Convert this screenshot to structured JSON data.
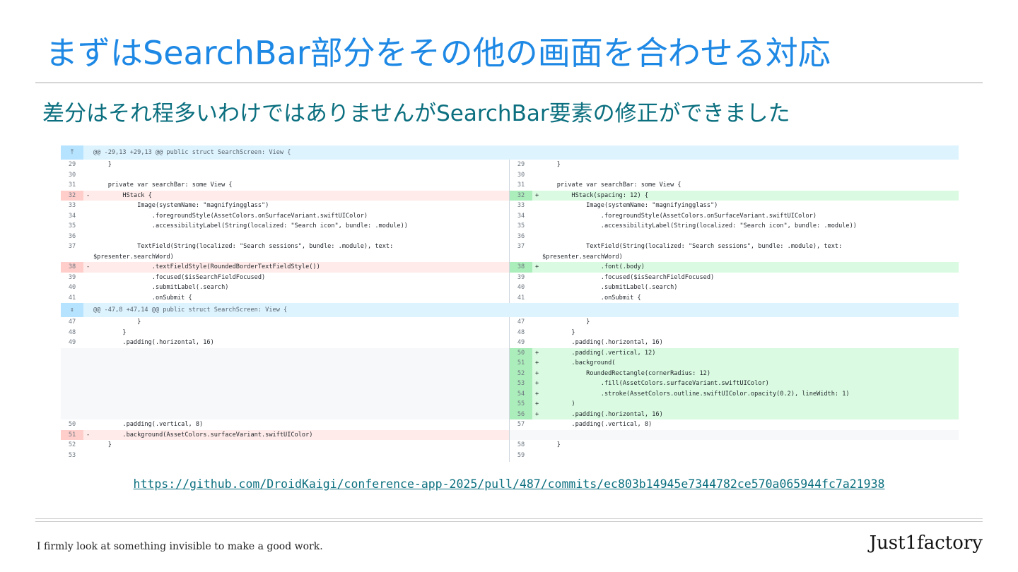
{
  "slide": {
    "title": "まずはSearchBar部分をその他の画面を合わせる対応",
    "subtitle": "差分はそれ程多いわけではありませんがSearchBar要素の修正ができました",
    "link": "https://github.com/DroidKaigi/conference-app-2025/pull/487/commits/ec803b14945e7344782ce570a065944fc7a21938",
    "footer_tagline": "I firmly look at something invisible to make a good work.",
    "brand": "Just1factory"
  },
  "diff": {
    "hunks": [
      {
        "expand_icon": "expand-up-icon",
        "header": "@@ -29,13 +29,13 @@ public struct SearchScreen: View {"
      },
      {
        "expand_icon": "expand-both-icon",
        "header": "@@ -47,8 +47,14 @@ public struct SearchScreen: View {"
      }
    ],
    "left": [
      {
        "num": "29",
        "sign": "",
        "type": "ctx",
        "code": "    }"
      },
      {
        "num": "30",
        "sign": "",
        "type": "ctx",
        "code": ""
      },
      {
        "num": "31",
        "sign": "",
        "type": "ctx",
        "code": "    private var searchBar: some View {"
      },
      {
        "num": "32",
        "sign": "-",
        "type": "del",
        "code": "        HStack {"
      },
      {
        "num": "33",
        "sign": "",
        "type": "ctx",
        "code": "            Image(systemName: \"magnifyingglass\")"
      },
      {
        "num": "34",
        "sign": "",
        "type": "ctx",
        "code": "                .foregroundStyle(AssetColors.onSurfaceVariant.swiftUIColor)"
      },
      {
        "num": "35",
        "sign": "",
        "type": "ctx",
        "code": "                .accessibilityLabel(String(localized: \"Search icon\", bundle: .module))"
      },
      {
        "num": "36",
        "sign": "",
        "type": "ctx",
        "code": ""
      },
      {
        "num": "37",
        "sign": "",
        "type": "ctx",
        "code": "            TextField(String(localized: \"Search sessions\", bundle: .module), text:"
      },
      {
        "num": "",
        "sign": "",
        "type": "ctx",
        "code": "$presenter.searchWord)"
      },
      {
        "num": "38",
        "sign": "-",
        "type": "del",
        "code": "                .textFieldStyle(RoundedBorderTextFieldStyle())"
      },
      {
        "num": "39",
        "sign": "",
        "type": "ctx",
        "code": "                .focused($isSearchFieldFocused)"
      },
      {
        "num": "40",
        "sign": "",
        "type": "ctx",
        "code": "                .submitLabel(.search)"
      },
      {
        "num": "41",
        "sign": "",
        "type": "ctx",
        "code": "                .onSubmit {"
      },
      {
        "num": "47",
        "sign": "",
        "type": "ctx",
        "code": "            }"
      },
      {
        "num": "48",
        "sign": "",
        "type": "ctx",
        "code": "        }"
      },
      {
        "num": "49",
        "sign": "",
        "type": "ctx",
        "code": "        .padding(.horizontal, 16)"
      },
      {
        "num": "50",
        "sign": "",
        "type": "ctx",
        "code": "        .padding(.vertical, 8)"
      },
      {
        "num": "51",
        "sign": "-",
        "type": "del",
        "code": "        .background(AssetColors.surfaceVariant.swiftUIColor)"
      },
      {
        "num": "52",
        "sign": "",
        "type": "ctx",
        "code": "    }"
      },
      {
        "num": "53",
        "sign": "",
        "type": "ctx",
        "code": ""
      }
    ],
    "right": [
      {
        "num": "29",
        "sign": "",
        "type": "ctx",
        "code": "    }"
      },
      {
        "num": "30",
        "sign": "",
        "type": "ctx",
        "code": ""
      },
      {
        "num": "31",
        "sign": "",
        "type": "ctx",
        "code": "    private var searchBar: some View {"
      },
      {
        "num": "32",
        "sign": "+",
        "type": "add",
        "code": "        HStack(spacing: 12) {"
      },
      {
        "num": "33",
        "sign": "",
        "type": "ctx",
        "code": "            Image(systemName: \"magnifyingglass\")"
      },
      {
        "num": "34",
        "sign": "",
        "type": "ctx",
        "code": "                .foregroundStyle(AssetColors.onSurfaceVariant.swiftUIColor)"
      },
      {
        "num": "35",
        "sign": "",
        "type": "ctx",
        "code": "                .accessibilityLabel(String(localized: \"Search icon\", bundle: .module))"
      },
      {
        "num": "36",
        "sign": "",
        "type": "ctx",
        "code": ""
      },
      {
        "num": "37",
        "sign": "",
        "type": "ctx",
        "code": "            TextField(String(localized: \"Search sessions\", bundle: .module), text:"
      },
      {
        "num": "",
        "sign": "",
        "type": "ctx",
        "code": "$presenter.searchWord)"
      },
      {
        "num": "38",
        "sign": "+",
        "type": "add",
        "code": "                .font(.body)"
      },
      {
        "num": "39",
        "sign": "",
        "type": "ctx",
        "code": "                .focused($isSearchFieldFocused)"
      },
      {
        "num": "40",
        "sign": "",
        "type": "ctx",
        "code": "                .submitLabel(.search)"
      },
      {
        "num": "41",
        "sign": "",
        "type": "ctx",
        "code": "                .onSubmit {"
      },
      {
        "num": "47",
        "sign": "",
        "type": "ctx",
        "code": "            }"
      },
      {
        "num": "48",
        "sign": "",
        "type": "ctx",
        "code": "        }"
      },
      {
        "num": "49",
        "sign": "",
        "type": "ctx",
        "code": "        .padding(.horizontal, 16)"
      },
      {
        "num": "50",
        "sign": "+",
        "type": "add",
        "code": "        .padding(.vertical, 12)"
      },
      {
        "num": "51",
        "sign": "+",
        "type": "add",
        "code": "        .background("
      },
      {
        "num": "52",
        "sign": "+",
        "type": "add",
        "code": "            RoundedRectangle(cornerRadius: 12)"
      },
      {
        "num": "53",
        "sign": "+",
        "type": "add",
        "code": "                .fill(AssetColors.surfaceVariant.swiftUIColor)"
      },
      {
        "num": "54",
        "sign": "+",
        "type": "add",
        "code": "                .stroke(AssetColors.outline.swiftUIColor.opacity(0.2), lineWidth: 1)"
      },
      {
        "num": "55",
        "sign": "+",
        "type": "add",
        "code": "        )"
      },
      {
        "num": "56",
        "sign": "+",
        "type": "add",
        "code": "        .padding(.horizontal, 16)"
      },
      {
        "num": "57",
        "sign": "",
        "type": "ctx",
        "code": "        .padding(.vertical, 8)"
      },
      {
        "num": "58",
        "sign": "",
        "type": "ctx",
        "code": "    }"
      },
      {
        "num": "59",
        "sign": "",
        "type": "ctx",
        "code": ""
      }
    ]
  }
}
